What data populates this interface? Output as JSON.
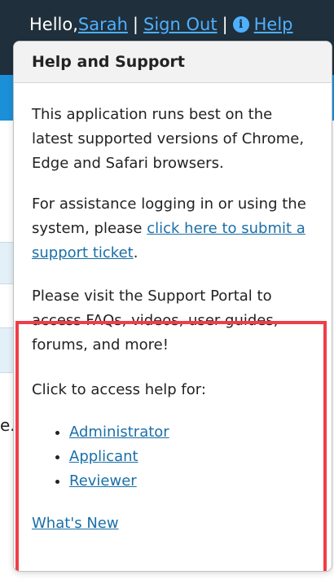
{
  "header": {
    "greeting": "Hello,",
    "user_name": "Sarah",
    "sign_out": "Sign Out",
    "help": "Help",
    "separator": "|"
  },
  "background": {
    "truncated_text": "e."
  },
  "help_popover": {
    "title": "Help and Support",
    "browser_note": "This application runs best on the latest supported versions of Chrome, Edge and Safari browsers.",
    "assistance_prefix": "For assistance logging in or using the system, please ",
    "assistance_link": "click here to submit a support ticket",
    "assistance_suffix": ".",
    "portal_text": "Please visit the Support Portal to access FAQs, videos, user guides, forums, and more!",
    "access_prompt": "Click to access help for:",
    "help_links": [
      "Administrator",
      "Applicant",
      "Reviewer"
    ],
    "whats_new": "What's New"
  },
  "colors": {
    "header_bg": "#1f2f3b",
    "link_blue": "#1a6fa8",
    "highlight_red": "#ef3e48"
  }
}
